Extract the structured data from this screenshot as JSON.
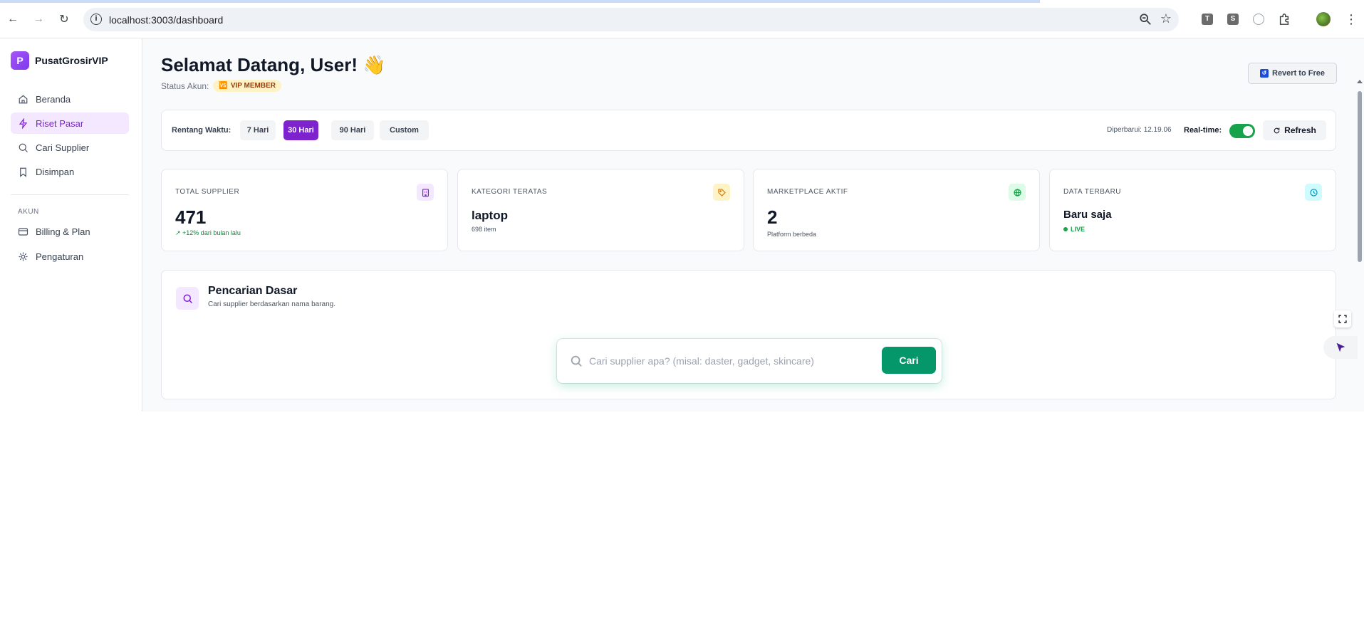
{
  "browser": {
    "url": "localhost:3003/dashboard",
    "extensions": [
      "T",
      "S"
    ]
  },
  "sidebar": {
    "brand_logo": "P",
    "brand_name": "PusatGrosirVIP",
    "items": [
      {
        "label": "Beranda",
        "icon": "home-icon"
      },
      {
        "label": "Riset Pasar",
        "icon": "lightning-icon",
        "active": true
      },
      {
        "label": "Cari Supplier",
        "icon": "search-icon"
      },
      {
        "label": "Disimpan",
        "icon": "bookmark-icon"
      }
    ],
    "section_label": "AKUN",
    "account_items": [
      {
        "label": "Billing & Plan",
        "icon": "credit-card-icon"
      },
      {
        "label": "Pengaturan",
        "icon": "gear-icon"
      }
    ]
  },
  "header": {
    "greeting": "Selamat Datang, User! 👋",
    "status_label": "Status Akun:",
    "badge": "VIP MEMBER",
    "badge_emoji": "🆚",
    "revert_label": "Revert to Free"
  },
  "filters": {
    "label": "Rentang Waktu:",
    "ranges": [
      "7 Hari",
      "30 Hari",
      "90 Hari",
      "Custom"
    ],
    "active_range": "30 Hari",
    "updated": "Diperbarui: 12.19.06",
    "realtime_label": "Real-time:",
    "realtime_on": true,
    "refresh_label": "Refresh"
  },
  "stats": [
    {
      "label": "TOTAL SUPPLIER",
      "value": "471",
      "sub": "↗ +12% dari bulan lalu",
      "icon": "building-icon",
      "icon_color": "#7e22ce",
      "icon_bg": "#f3e8ff"
    },
    {
      "label": "KATEGORI TERATAS",
      "value": "laptop",
      "sub": "698 item",
      "icon": "tag-icon",
      "icon_color": "#d97706",
      "icon_bg": "#fef3c7"
    },
    {
      "label": "MARKETPLACE AKTIF",
      "value": "2",
      "sub": "Platform berbeda",
      "icon": "globe-icon",
      "icon_color": "#16a34a",
      "icon_bg": "#dcfce7"
    },
    {
      "label": "DATA TERBARU",
      "value": "Baru saja",
      "sub": "LIVE",
      "icon": "clock-icon",
      "icon_color": "#0891b2",
      "icon_bg": "#cffafe"
    }
  ],
  "search": {
    "title": "Pencarian Dasar",
    "description": "Cari supplier berdasarkan nama barang.",
    "placeholder": "Cari supplier apa? (misal: daster, gadget, skincare)",
    "button_label": "Cari"
  },
  "colors": {
    "accent": "#7e22ce",
    "success": "#059669",
    "toggle_on": "#16a34a"
  }
}
